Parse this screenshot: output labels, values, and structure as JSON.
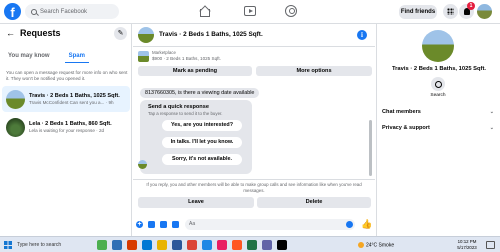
{
  "topbar": {
    "search_placeholder": "Search Facebook",
    "find_friends_label": "Find friends",
    "notification_count": "1"
  },
  "left": {
    "title": "Requests",
    "tabs": [
      {
        "label": "You may know",
        "active": false
      },
      {
        "label": "Spam",
        "active": true
      }
    ],
    "info_text": "You can open a message request for more info on who sent it. They won't be notified you opened it.",
    "requests": [
      {
        "title": "Travis · 2 Beds 1 Baths, 1025 Sqft.",
        "preview": "Travis McConfident Can sent you a... · 9h",
        "selected": true
      },
      {
        "title": "Lela · 2 Beds 1 Baths, 860 Sqft.",
        "preview": "Lela is waiting for your response · 2d",
        "selected": false
      }
    ]
  },
  "chat": {
    "title": "Travis · 2 Beds 1 Baths, 1025 Sqft.",
    "marketplace_label": "Marketplace",
    "listing_price": "$900 · 2 Beds 1 Baths, 1025 Sqft.",
    "mark_pending_label": "Mark as pending",
    "more_options_label": "More options",
    "message": "8137660305, is there a viewing date available",
    "quick_title": "Send a quick response",
    "quick_subtitle": "Tap a response to send it to the buyer.",
    "quick_options": [
      "Yes, are you interested?",
      "In talks. I'll let you know.",
      "Sorry, it's not available."
    ],
    "notice": "If you reply, you and other members will be able to make group calls and see information like when you've read messages.",
    "leave_label": "Leave",
    "delete_label": "Delete",
    "composer_placeholder": "Aa"
  },
  "right": {
    "title": "Travis · 2 Beds 1 Baths, 1025 Sqft.",
    "search_label": "Search",
    "chat_members_label": "Chat members",
    "privacy_label": "Privacy & support"
  },
  "taskbar": {
    "search_label": "Type here to search",
    "weather": "24°C  Smoke",
    "time": "10:12 PM",
    "date": "5/17/2023"
  },
  "colors": {
    "accent": "#1877f2",
    "selected_bg": "#e7f3ff",
    "badge": "#e41e3f"
  },
  "icons": [
    "facebook-logo",
    "search-icon",
    "home-icon",
    "watch-icon",
    "groups-icon",
    "menu-grid-icon",
    "bell-icon",
    "back-arrow-icon",
    "edit-icon",
    "info-icon",
    "plus-icon",
    "emoji-icon",
    "like-icon",
    "windows-start-icon",
    "weather-icon"
  ]
}
